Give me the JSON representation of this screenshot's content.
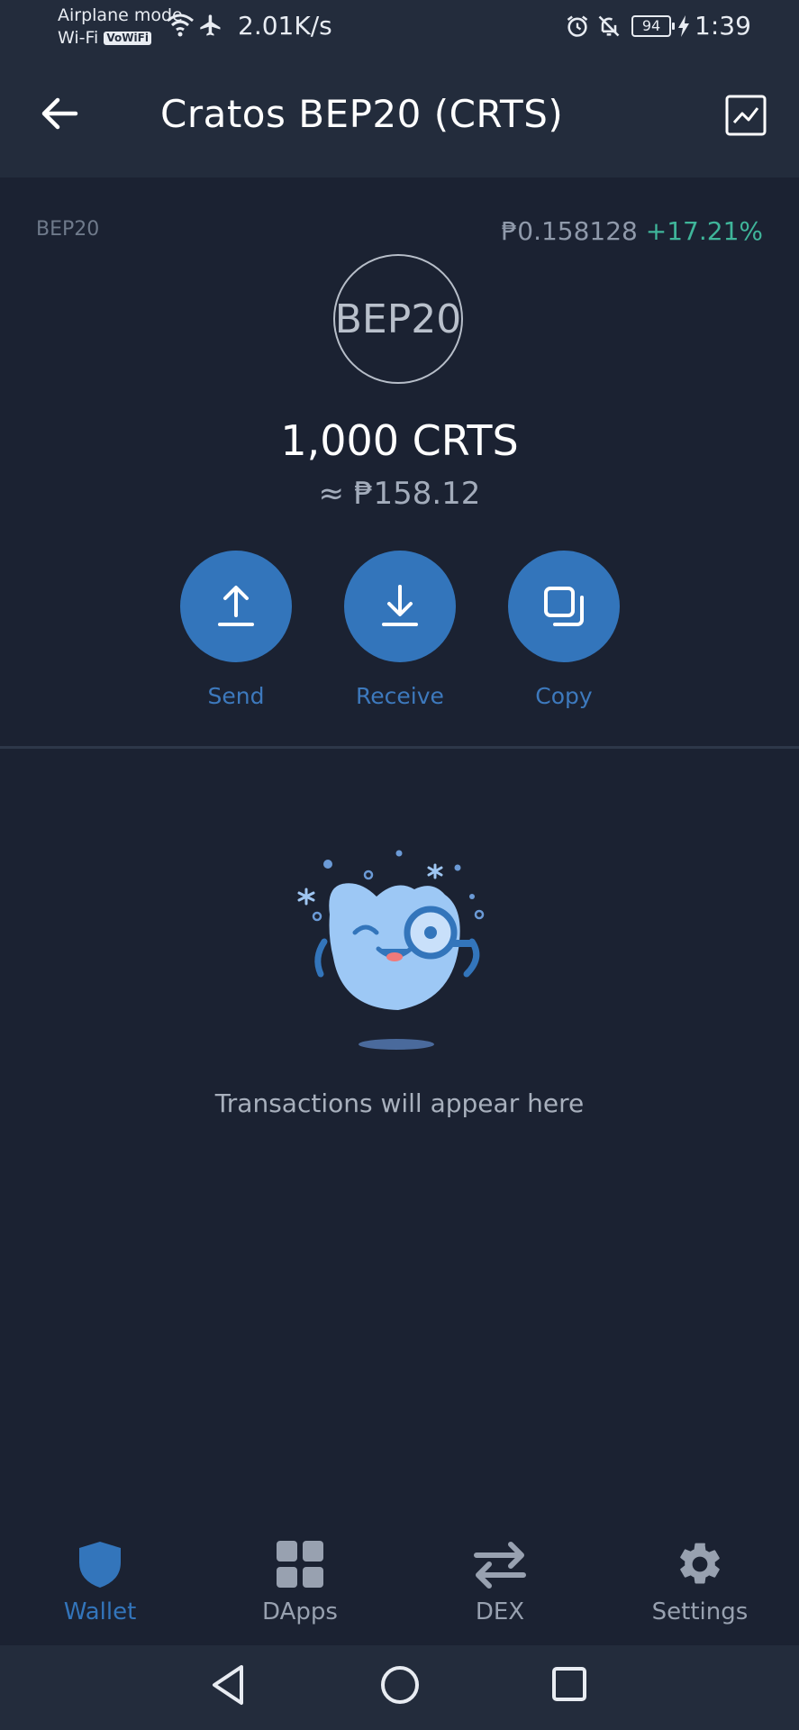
{
  "status_bar": {
    "airplane_mode": "Airplane mode",
    "wifi": "Wi-Fi",
    "vowifi": "VoWiFi",
    "speed": "2.01K/s",
    "battery": "94",
    "time": "1:39"
  },
  "header": {
    "title": "Cratos BEP20 (CRTS)"
  },
  "token": {
    "network": "BEP20",
    "price": "₱0.158128",
    "change": "+17.21%",
    "logo_text": "BEP20",
    "balance": "1,000 CRTS",
    "fiat_value": "≈ ₱158.12"
  },
  "actions": [
    {
      "label": "Send",
      "icon": "upload-icon"
    },
    {
      "label": "Receive",
      "icon": "download-icon"
    },
    {
      "label": "Copy",
      "icon": "copy-icon"
    }
  ],
  "empty_state": {
    "message": "Transactions will appear here"
  },
  "bottom_nav": [
    {
      "label": "Wallet",
      "icon": "shield-icon",
      "active": true
    },
    {
      "label": "DApps",
      "icon": "grid-icon",
      "active": false
    },
    {
      "label": "DEX",
      "icon": "swap-icon",
      "active": false
    },
    {
      "label": "Settings",
      "icon": "gear-icon",
      "active": false
    }
  ],
  "colors": {
    "background": "#1b2232",
    "header": "#232c3c",
    "accent": "#3375bb",
    "positive": "#3fb59a"
  }
}
